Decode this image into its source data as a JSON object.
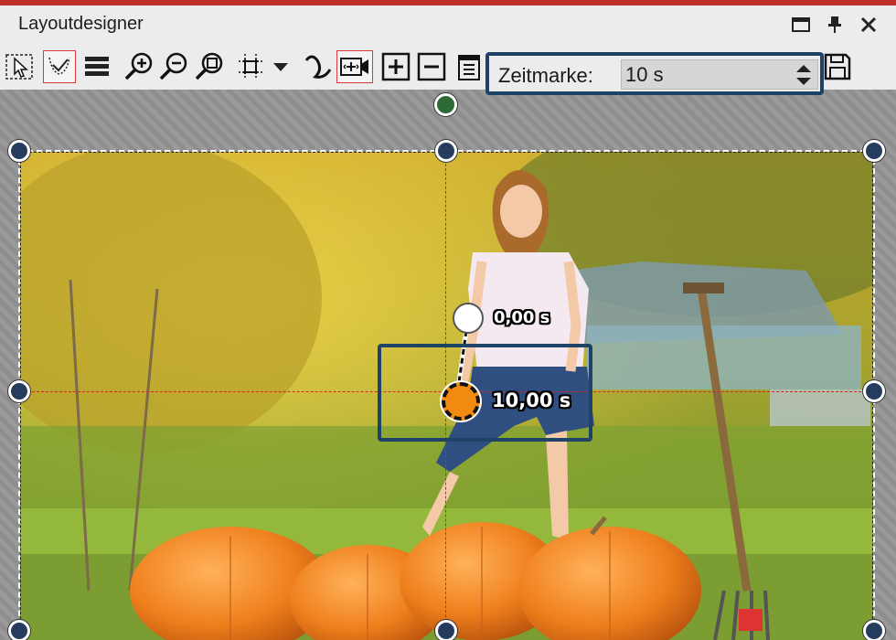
{
  "window": {
    "title": "Layoutdesigner"
  },
  "toolbar": {
    "tools": [
      "select-icon",
      "path-edit-icon",
      "layers-icon",
      "zoom-in-icon",
      "zoom-out-icon",
      "zoom-fit-icon",
      "grid-icon",
      "dropdown-icon",
      "curve-icon",
      "camera-keyframe-icon",
      "add-icon",
      "remove-icon",
      "keyframe-list-icon",
      "save-icon"
    ]
  },
  "timestamp": {
    "label": "Zeitmarke:",
    "value": "10 s"
  },
  "keyframes": {
    "start_label": "0,00 s",
    "end_label": "10,00 s"
  },
  "colors": {
    "accent_red": "#c0302b",
    "highlight_border": "#1e4366",
    "handle_fill": "#263c5f",
    "rotate_handle": "#2d6a35",
    "keyframe_end": "#f18a10"
  }
}
